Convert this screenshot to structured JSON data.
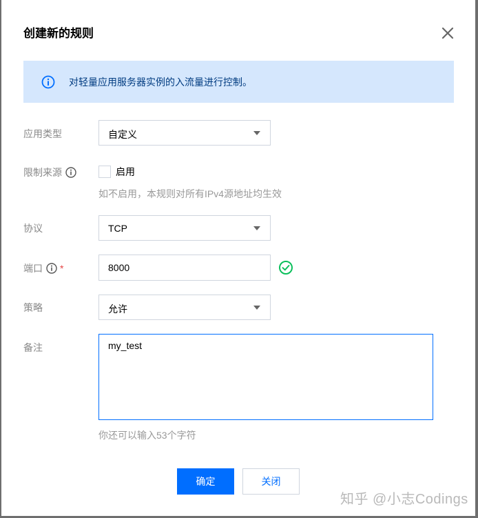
{
  "dialog": {
    "title": "创建新的规则",
    "notice": "对轻量应用服务器实例的入流量进行控制。"
  },
  "form": {
    "app_type": {
      "label": "应用类型",
      "value": "自定义"
    },
    "limit_source": {
      "label": "限制来源",
      "checkbox_label": "启用",
      "checked": false,
      "hint": "如不启用，本规则对所有IPv4源地址均生效"
    },
    "protocol": {
      "label": "协议",
      "value": "TCP"
    },
    "port": {
      "label": "端口",
      "required_mark": "*",
      "value": "8000"
    },
    "policy": {
      "label": "策略",
      "value": "允许"
    },
    "remark": {
      "label": "备注",
      "value": "my_test",
      "counter": "你还可以输入53个字符"
    }
  },
  "buttons": {
    "confirm": "确定",
    "close": "关闭"
  },
  "watermark": "知乎 @小志Codings",
  "colors": {
    "primary": "#006eff",
    "notice_bg": "#d5e7fd",
    "success": "#0abf5b",
    "required": "#e54545"
  },
  "icons": {
    "close": "close-icon",
    "notice": "info-circle-icon",
    "field_info": "info-circle-icon",
    "valid": "check-circle-icon",
    "dropdown": "caret-down-icon"
  }
}
